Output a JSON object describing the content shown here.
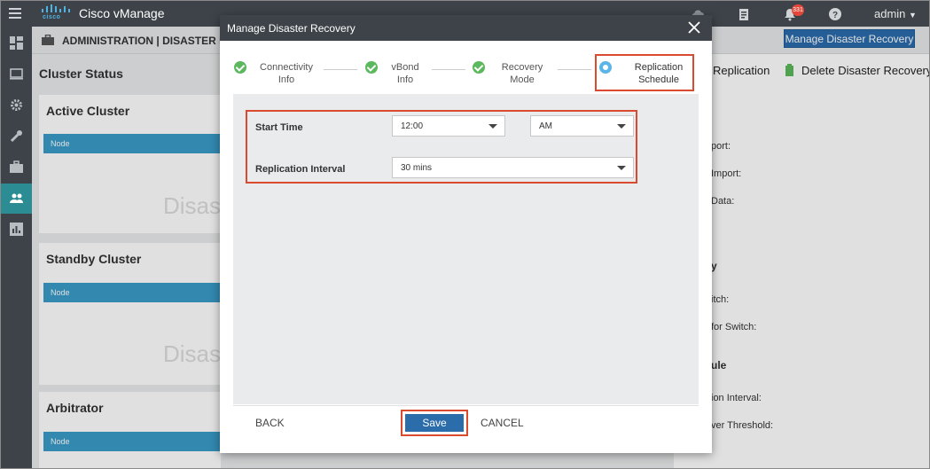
{
  "app": {
    "title": "Cisco vManage",
    "logo_text": "cisco"
  },
  "topbar": {
    "notification_count": "331",
    "user": "admin"
  },
  "subheader": {
    "title": "ADMINISTRATION | DISASTER RECO",
    "manage_button": "Manage Disaster Recovery"
  },
  "main": {
    "cluster_status": "Cluster Status",
    "clusters": [
      {
        "title": "Active Cluster",
        "column": "Node",
        "watermark": "Disas"
      },
      {
        "title": "Standby Cluster",
        "column": "Node",
        "watermark": "Disas"
      },
      {
        "title": "Arbitrator",
        "column": "Node"
      }
    ]
  },
  "right_panel": {
    "actions": {
      "replication": "Replication",
      "delete": "Delete Disaster Recovery"
    },
    "labels": [
      "port:",
      "Import:",
      "Data:",
      "y",
      "itch:",
      "for Switch:",
      "ule",
      "ion Interval:",
      "ver Threshold:"
    ]
  },
  "modal": {
    "title": "Manage Disaster Recovery",
    "steps": [
      {
        "line1": "Connectivity",
        "line2": "Info",
        "status": "complete"
      },
      {
        "line1": "vBond",
        "line2": "Info",
        "status": "complete"
      },
      {
        "line1": "Recovery",
        "line2": "Mode",
        "status": "complete"
      },
      {
        "line1": "Replication",
        "line2": "Schedule",
        "status": "current"
      }
    ],
    "form": {
      "start_time_label": "Start Time",
      "start_time_value": "12:00",
      "ampm_value": "AM",
      "interval_label": "Replication Interval",
      "interval_value": "30 mins"
    },
    "footer": {
      "back": "BACK",
      "save": "Save",
      "cancel": "CANCEL"
    }
  },
  "colors": {
    "accent": "#2b6cab",
    "highlight": "#d94a2e",
    "success": "#5cb85c",
    "current_step": "#5bb5e6",
    "topbar": "#3d4349"
  }
}
